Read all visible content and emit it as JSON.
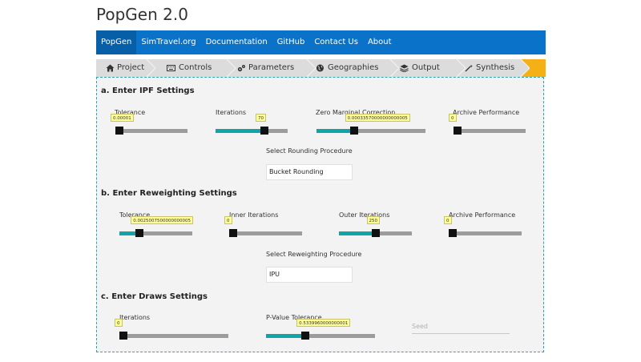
{
  "app_title": "PopGen 2.0",
  "nav": [
    "PopGen",
    "SimTravel.org",
    "Documentation",
    "GitHub",
    "Contact Us",
    "About"
  ],
  "crumbs": [
    {
      "label": "Project",
      "icon": "home-icon"
    },
    {
      "label": "Controls",
      "icon": "keyboard-icon"
    },
    {
      "label": "Parameters",
      "icon": "gears-icon"
    },
    {
      "label": "Geographies",
      "icon": "globe-icon"
    },
    {
      "label": "Output",
      "icon": "layers-icon"
    },
    {
      "label": "Synthesis",
      "icon": "magic-wand-icon"
    }
  ],
  "colors": {
    "nav_bg": "#0a73c9",
    "accent": "#11a3a7",
    "crumb_end": "#f5b015",
    "tooltip_bg": "#ffff99"
  },
  "ipf": {
    "title": "a. Enter IPF Settings",
    "tolerance": {
      "label": "Tolerance",
      "value": "0.00001",
      "level": 0
    },
    "iterations": {
      "label": "Iterations",
      "value": "70",
      "level": 0.7
    },
    "zero_marginal": {
      "label": "Zero Marginal Correction",
      "value": "0.00033570000000000005",
      "level": 0.33
    },
    "archive": {
      "label": "Archive Performance",
      "value": "0",
      "level": 0
    },
    "rounding_label": "Select Rounding Procedure",
    "rounding_value": "Bucket Rounding"
  },
  "reweighting": {
    "title": "b. Enter Reweighting Settings",
    "tolerance": {
      "label": "Tolerance",
      "value": "0.0025007500000000005",
      "level": 0.25
    },
    "inner": {
      "label": "Inner Iterations",
      "value": "0",
      "level": 0
    },
    "outer": {
      "label": "Outer Iterations",
      "value": "250",
      "level": 0.5
    },
    "archive": {
      "label": "Archive Performance",
      "value": "0",
      "level": 0
    },
    "procedure_label": "Select Reweighting Procedure",
    "procedure_value": "IPU"
  },
  "draws": {
    "title": "c. Enter Draws Settings",
    "iterations": {
      "label": "Iterations",
      "value": "0",
      "level": 0
    },
    "pvalue": {
      "label": "P-Value Tolerance",
      "value": "0.5339960000000001",
      "level": 0.35
    },
    "seed_placeholder": "Seed"
  }
}
